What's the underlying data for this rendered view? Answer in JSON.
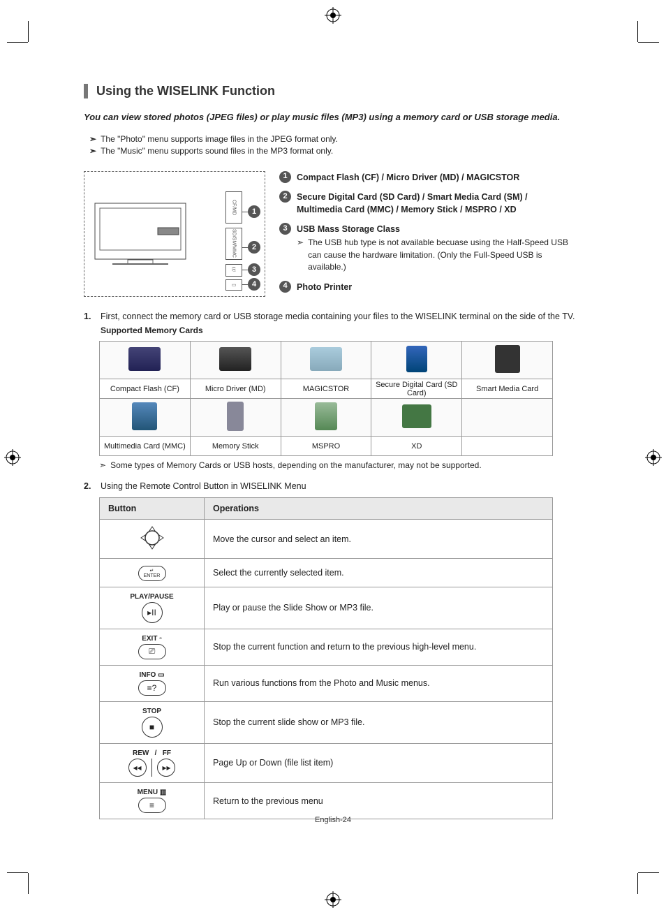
{
  "heading": "Using the WISELINK Function",
  "intro": "You can view stored photos (JPEG files) or play music files (MP3) using a memory card or USB storage media.",
  "bullets": [
    "The \"Photo\" menu supports image files in the JPEG format only.",
    "The \"Music\" menu supports sound files in the MP3 format only."
  ],
  "ports": [
    {
      "n": "1",
      "label": "Compact Flash (CF)  / Micro Driver (MD) / MAGICSTOR"
    },
    {
      "n": "2",
      "label": "Secure Digital Card (SD Card) / Smart Media Card (SM) / Multimedia Card (MMC) / Memory Stick / MSPRO / XD"
    },
    {
      "n": "3",
      "label": "USB Mass Storage Class",
      "sub": [
        "The USB hub type is not available becuase using the Half-Speed USB can cause the hardware limitation. (Only the Full-Speed USB is available.)"
      ]
    },
    {
      "n": "4",
      "label": "Photo Printer"
    }
  ],
  "step1": {
    "n": "1.",
    "text": "First, connect the memory card or USB storage media containing your files to the WISELINK terminal on the side of the TV.",
    "subhead": "Supported Memory Cards"
  },
  "cards_row1": [
    "Compact Flash (CF)",
    "Micro Driver (MD)",
    "MAGICSTOR",
    "Secure Digital Card (SD Card)",
    "Smart Media Card"
  ],
  "cards_row2": [
    "Multimedia Card (MMC)",
    "Memory Stick",
    "MSPRO",
    "XD",
    ""
  ],
  "cards_note": "Some types of Memory Cards or USB hosts, depending on the manufacturer, may not be supported.",
  "step2": {
    "n": "2.",
    "text": "Using the Remote Control Button in WISELINK Menu"
  },
  "ops_header": {
    "button": "Button",
    "operations": "Operations"
  },
  "ops": [
    {
      "icon": "dpad",
      "label": "",
      "op": "Move the cursor and select an item."
    },
    {
      "icon": "enter",
      "label": "",
      "op": "Select the currently selected item."
    },
    {
      "icon": "playpause",
      "label": "PLAY/PAUSE",
      "op": "Play or pause the Slide Show or MP3 file."
    },
    {
      "icon": "exit",
      "label": "EXIT",
      "op": "Stop the current function and return to the previous high-level menu."
    },
    {
      "icon": "info",
      "label": "INFO",
      "op": "Run various functions from the Photo and Music menus."
    },
    {
      "icon": "stop",
      "label": "STOP",
      "op": "Stop the current slide show or MP3 file."
    },
    {
      "icon": "rewff",
      "label": "REW / FF",
      "op": "Page Up or Down (file list item)"
    },
    {
      "icon": "menu",
      "label": "MENU",
      "op": "Return to the previous menu"
    }
  ],
  "footer": "English-24"
}
